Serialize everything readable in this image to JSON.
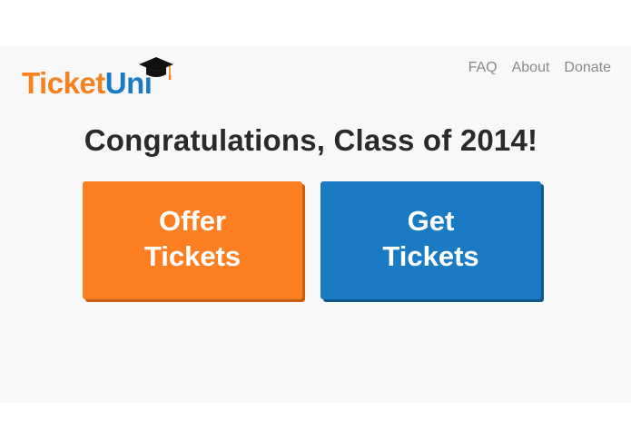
{
  "brand": {
    "logo_part1": "Ticket",
    "logo_part2": "Uni",
    "accent_orange": "#fd7f21",
    "accent_blue": "#1a7bc4",
    "logo_icon": "graduation-cap-icon"
  },
  "nav": {
    "items": [
      {
        "label": "FAQ"
      },
      {
        "label": "About"
      },
      {
        "label": "Donate"
      }
    ]
  },
  "main": {
    "headline": "Congratulations, Class of 2014!",
    "offer_button": {
      "line1": "Offer",
      "line2": "Tickets"
    },
    "get_button": {
      "line1": "Get",
      "line2": "Tickets"
    }
  }
}
